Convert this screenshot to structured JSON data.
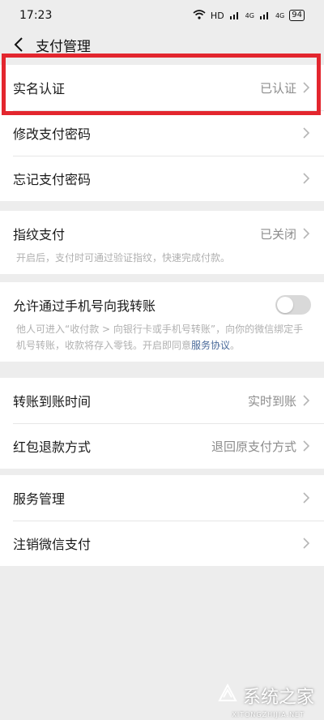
{
  "status_bar": {
    "time": "17:23",
    "network": "HD",
    "signal1": "4G",
    "signal2": "4G",
    "battery": "94"
  },
  "nav": {
    "title": "支付管理"
  },
  "rows": {
    "real_name": {
      "label": "实名认证",
      "value": "已认证"
    },
    "change_pwd": {
      "label": "修改支付密码"
    },
    "forgot_pwd": {
      "label": "忘记支付密码"
    },
    "fingerprint": {
      "label": "指纹支付",
      "value": "已关闭",
      "desc": "开启后，支付时可通过验证指纹，快速完成付款。"
    },
    "phone_transfer": {
      "label": "允许通过手机号向我转账",
      "desc": "他人可进入“收付款 > 向银行卡或手机号转账”，向你的微信绑定手机号转账，收款将存入零钱。开启即同意",
      "desc_link": "服务协议",
      "desc_end": "。",
      "enabled": false
    },
    "transfer_time": {
      "label": "转账到账时间",
      "value": "实时到账"
    },
    "redpacket_refund": {
      "label": "红包退款方式",
      "value": "退回原支付方式"
    },
    "service_mgmt": {
      "label": "服务管理"
    },
    "cancel_wechat_pay": {
      "label": "注销微信支付"
    }
  },
  "watermark": {
    "text": "系统之家",
    "sub": "XITONGZHIJIA.NET"
  },
  "colors": {
    "highlight": "#e3262e",
    "link": "#4a6a9a"
  }
}
